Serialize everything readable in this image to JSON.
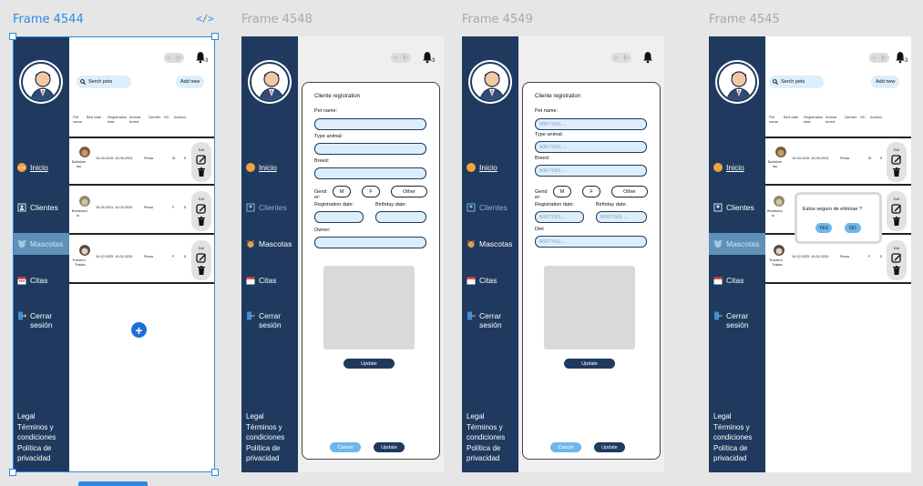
{
  "frames": [
    {
      "title": "Frame 4544"
    },
    {
      "title": "Frame 4548"
    },
    {
      "title": "Frame 4549"
    },
    {
      "title": "Frame 4545"
    }
  ],
  "code_icon": "</>",
  "sidebar": {
    "nav": {
      "inicio": "Inicio",
      "clientes": "Clientes",
      "mascotas": "Mascotas",
      "citas": "Citas",
      "cerrar_1": "Cerrar",
      "cerrar_2": "sesión"
    },
    "legal": [
      "Legal",
      "Términos y",
      "condiciones",
      "Política de",
      "privacidad"
    ]
  },
  "topbar": {
    "bell_count": "3",
    "toggle_left": "○",
    "toggle_right": "|○"
  },
  "search": {
    "placeholder": "Serch pets",
    "add_new": "Add new"
  },
  "table": {
    "headers": [
      "Pet name",
      "Bird date",
      "Registration date",
      "Animal breed",
      "Gender",
      "HC",
      "Actions"
    ],
    "rows": [
      {
        "pet": [
          "Bartolom",
          "lau"
        ],
        "bird": "10-03-2015",
        "reg": "10-09-2024",
        "breed": "Persa",
        "gender": "M",
        "hc": "5",
        "edit": "Edit"
      },
      {
        "pet": [
          "Bombonci",
          "to"
        ],
        "bird": "15-05-2021",
        "reg": "10-03-2020",
        "breed": "Persa",
        "gender": "F",
        "hc": "5",
        "edit": "Edit"
      },
      {
        "pet": [
          "Trololero",
          "Tralala"
        ],
        "bird": "19-12-2025",
        "reg": "10-02-2020",
        "breed": "Persa",
        "gender": "F",
        "hc": "5",
        "edit": "Edit"
      }
    ]
  },
  "form_a": {
    "title": "Cliente registration",
    "pet_name": "Pet name:",
    "type_animal": "Type animal:",
    "breed": "Breed:",
    "gender": "Gend er:",
    "gender_m": "M",
    "gender_f": "F",
    "gender_other": "Other",
    "registration_date": "Registration date:",
    "birthday_date": "Birthday date:",
    "owner": "Owner:",
    "update_inline": "Update",
    "cancel": "Cancel",
    "update": "Update"
  },
  "form_b": {
    "title": "Cliente registration",
    "pet_name": "Pet name:",
    "type_animal": "Type animal:",
    "breed": "Breed:",
    "gender": "Gend er:",
    "gender_m": "M",
    "gender_f": "F",
    "gender_other": "Other",
    "registration_date": "Registration date:",
    "birthday_date": "Birthday date:",
    "diet": "Diet",
    "placeholder": "WRITING....",
    "update_inline": "Update",
    "cancel": "Cancel",
    "update": "Update"
  },
  "dialog": {
    "question": "Estos seguro de eliminar ?",
    "yes": "YES",
    "no": "NO"
  },
  "colors": {
    "sidebar": "#1f3a5e",
    "active_nav": "#5f90b8",
    "selection": "#2c8ae8",
    "pill_bg": "#dbeefb"
  }
}
